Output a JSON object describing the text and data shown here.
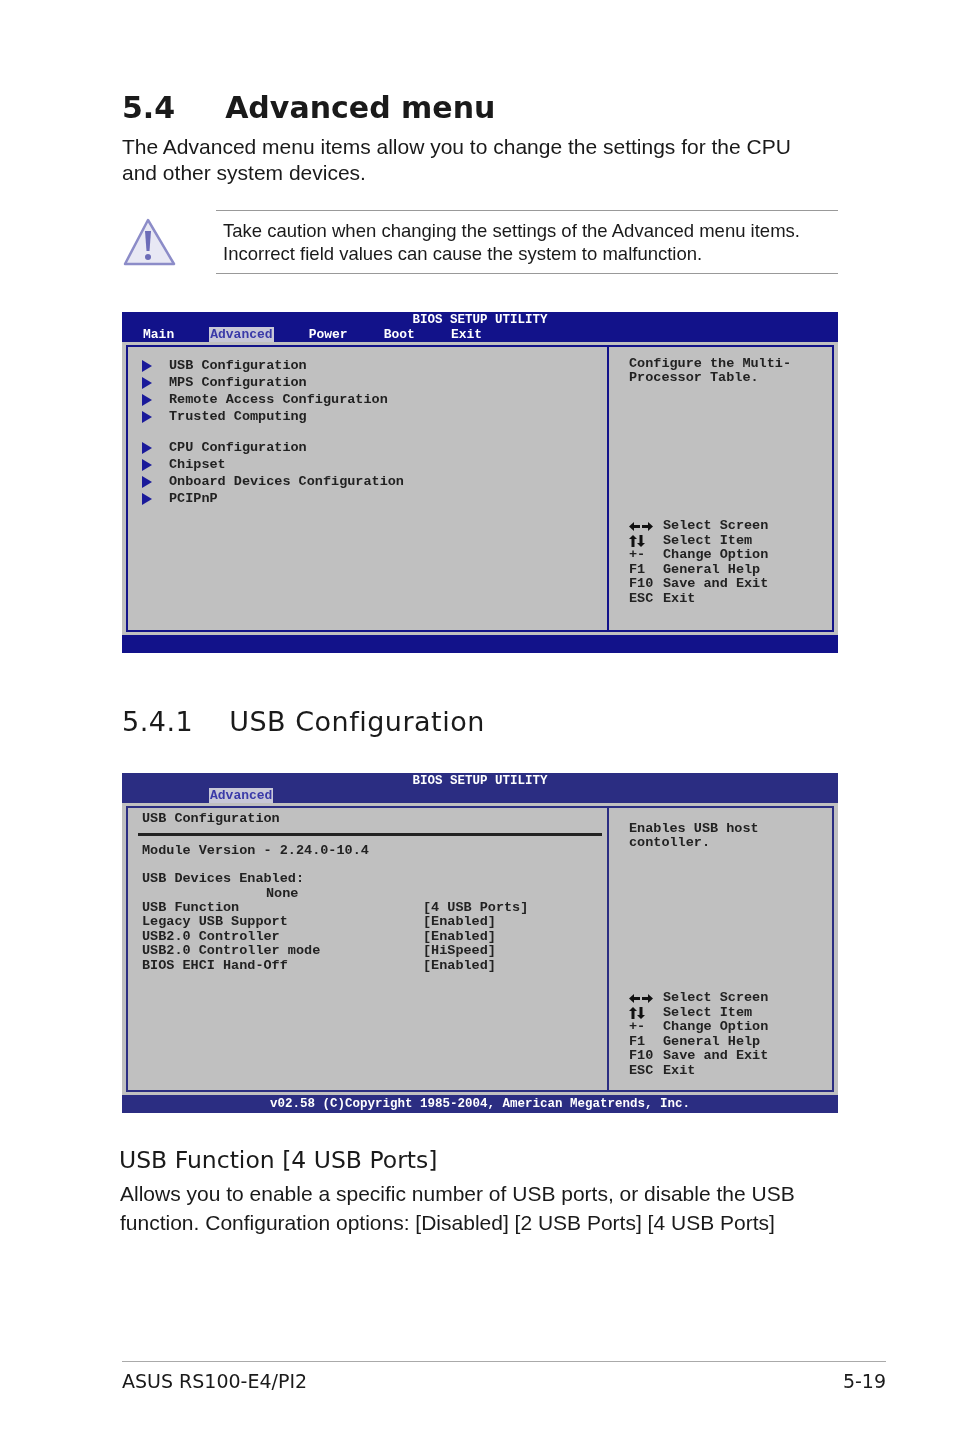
{
  "section": {
    "number": "5.4",
    "title": "Advanced menu",
    "intro": "The Advanced menu items allow you to change the settings for the CPU and other system devices."
  },
  "caution": {
    "text": "Take caution when changing the settings of the Advanced menu items. Incorrect field values can cause the system to malfunction."
  },
  "screen_1": {
    "title": "BIOS SETUP UTILITY",
    "tabs": [
      {
        "label": "Main",
        "selected": false
      },
      {
        "label": "Advanced",
        "selected": true
      },
      {
        "label": "Power",
        "selected": false
      },
      {
        "label": "Boot",
        "selected": false
      },
      {
        "label": "Exit",
        "selected": false
      }
    ],
    "groups": [
      [
        "USB Configuration",
        "MPS Configuration",
        "Remote Access Configuration",
        "Trusted Computing"
      ],
      [
        "CPU Configuration",
        "Chipset",
        "Onboard Devices Configuration",
        "PCIPnP"
      ]
    ],
    "help": "Configure the Multi- Processor Table.",
    "legend": [
      {
        "kind": "lr",
        "action": "Select Screen"
      },
      {
        "kind": "ud",
        "action": "Select Item"
      },
      {
        "kind": "key",
        "key": "+-",
        "action": "Change Option"
      },
      {
        "kind": "key",
        "key": "F1",
        "action": "General Help"
      },
      {
        "kind": "key",
        "key": "F10",
        "action": "Save and Exit"
      },
      {
        "kind": "key",
        "key": "ESC",
        "action": "Exit"
      }
    ]
  },
  "subsection": {
    "number": "5.4.1",
    "title": "USB Configuration"
  },
  "screen_2": {
    "title": "BIOS SETUP UTILITY",
    "tabs": [
      {
        "label": "Advanced",
        "selected": true
      }
    ],
    "heading": "USB Configuration",
    "module_version": "Module Version - 2.24.0-10.4",
    "devices_label": "USB Devices Enabled:",
    "devices_value": "None",
    "settings": [
      {
        "label": "USB Function",
        "value": "[4 USB Ports]"
      },
      {
        "label": "Legacy USB Support",
        "value": "[Enabled]"
      },
      {
        "label": "USB2.0 Controller",
        "value": "[Enabled]"
      },
      {
        "label": "USB2.0 Controller mode",
        "value": "[HiSpeed]"
      },
      {
        "label": "BIOS EHCI Hand-Off",
        "value": "[Enabled]"
      }
    ],
    "help": "Enables USB host contoller.",
    "legend": [
      {
        "kind": "lr",
        "action": "Select Screen"
      },
      {
        "kind": "ud",
        "action": "Select Item"
      },
      {
        "kind": "key",
        "key": "+-",
        "action": "Change Option"
      },
      {
        "kind": "key",
        "key": "F1",
        "action": "General Help"
      },
      {
        "kind": "key",
        "key": "F10",
        "action": "Save and Exit"
      },
      {
        "kind": "key",
        "key": "ESC",
        "action": "Exit"
      }
    ],
    "footer": "v02.58 (C)Copyright 1985-2004, American Megatrends, Inc."
  },
  "option": {
    "heading": "USB Function [4 USB Ports]",
    "description": "Allows you to enable a specific number of USB ports, or disable the USB function. Configuration options: [Disabled] [2 USB Ports] [4 USB Ports]"
  },
  "footer": {
    "product": "ASUS RS100-E4/PI2",
    "page": "5-19"
  }
}
